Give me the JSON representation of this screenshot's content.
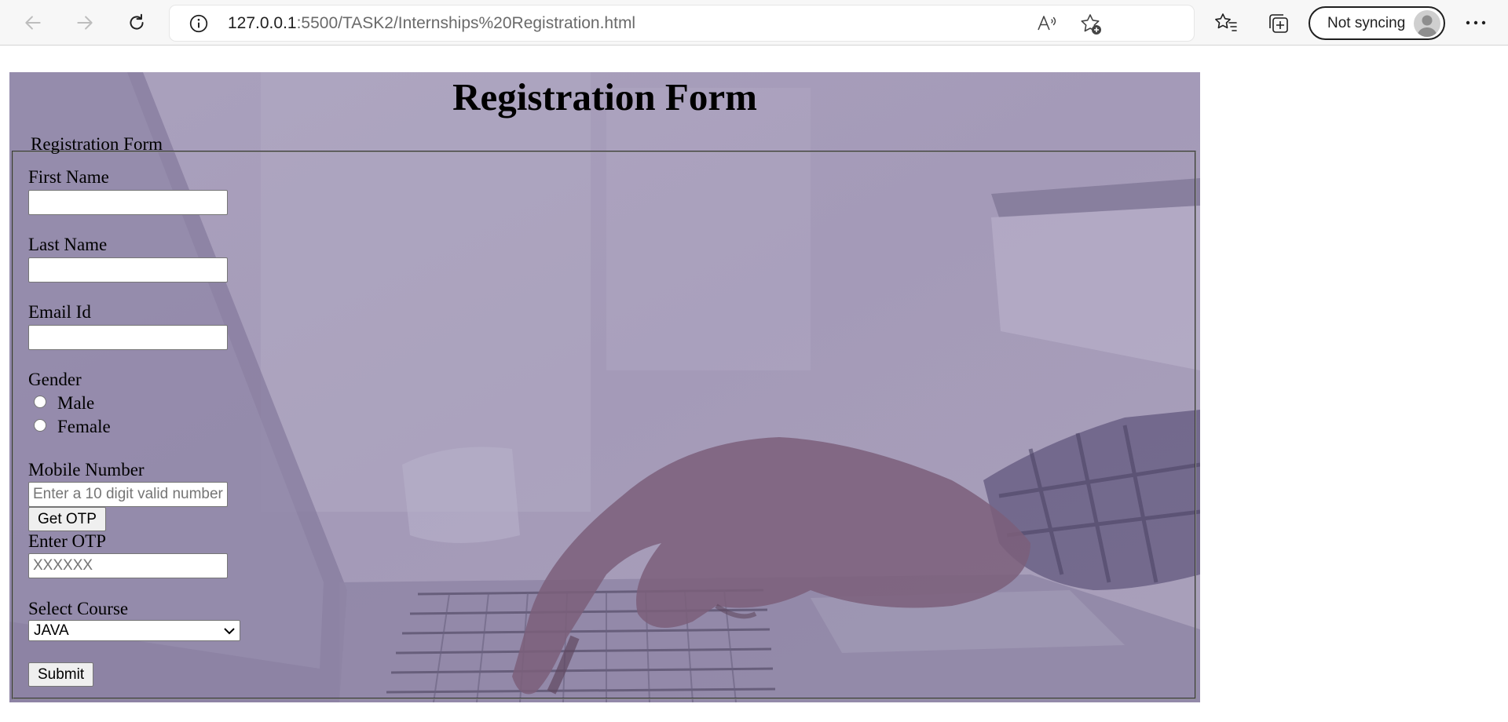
{
  "browser": {
    "url_host": "127.0.0.1",
    "url_rest": ":5500/TASK2/Internships%20Registration.html",
    "sync_label": "Not syncing"
  },
  "page": {
    "heading": "Registration Form",
    "legend": "Registration Form",
    "first_name_label": "First Name",
    "first_name_value": "",
    "last_name_label": "Last Name",
    "last_name_value": "",
    "email_label": "Email Id",
    "email_value": "",
    "gender_label": "Gender",
    "gender_options": [
      "Male",
      "Female"
    ],
    "mobile_label": "Mobile Number",
    "mobile_placeholder": "Enter a 10 digit valid number",
    "get_otp_label": "Get OTP",
    "otp_label": "Enter OTP",
    "otp_placeholder": "XXXXXX",
    "course_label": "Select Course",
    "course_selected": "JAVA",
    "submit_label": "Submit"
  }
}
